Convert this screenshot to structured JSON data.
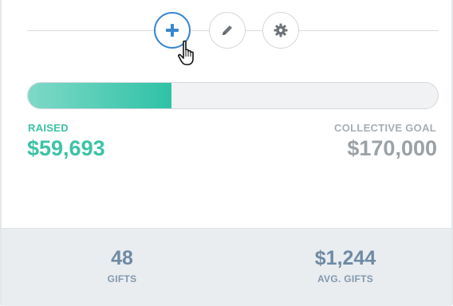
{
  "toolbar": {
    "buttons": [
      {
        "name": "add",
        "icon": "plus-icon",
        "active": true
      },
      {
        "name": "edit",
        "icon": "pencil-icon",
        "active": false
      },
      {
        "name": "settings",
        "icon": "gear-icon",
        "active": false
      }
    ],
    "cursor": "hand-pointer-icon"
  },
  "campaign": {
    "raised_label": "RAISED",
    "raised_value": "$59,693",
    "goal_label": "COLLECTIVE GOAL",
    "goal_value": "$170,000",
    "progress_fraction": 0.3511
  },
  "stats": {
    "gifts_value": "48",
    "gifts_label": "GIFTS",
    "avg_value": "$1,244",
    "avg_label": "AVG. GIFTS"
  },
  "colors": {
    "accent_teal": "#3cc3a6",
    "active_blue": "#3a86cf",
    "muted_gray": "#9aa1a7",
    "stats_blue": "#6f8aa3",
    "stats_bg": "#e9edf0"
  }
}
